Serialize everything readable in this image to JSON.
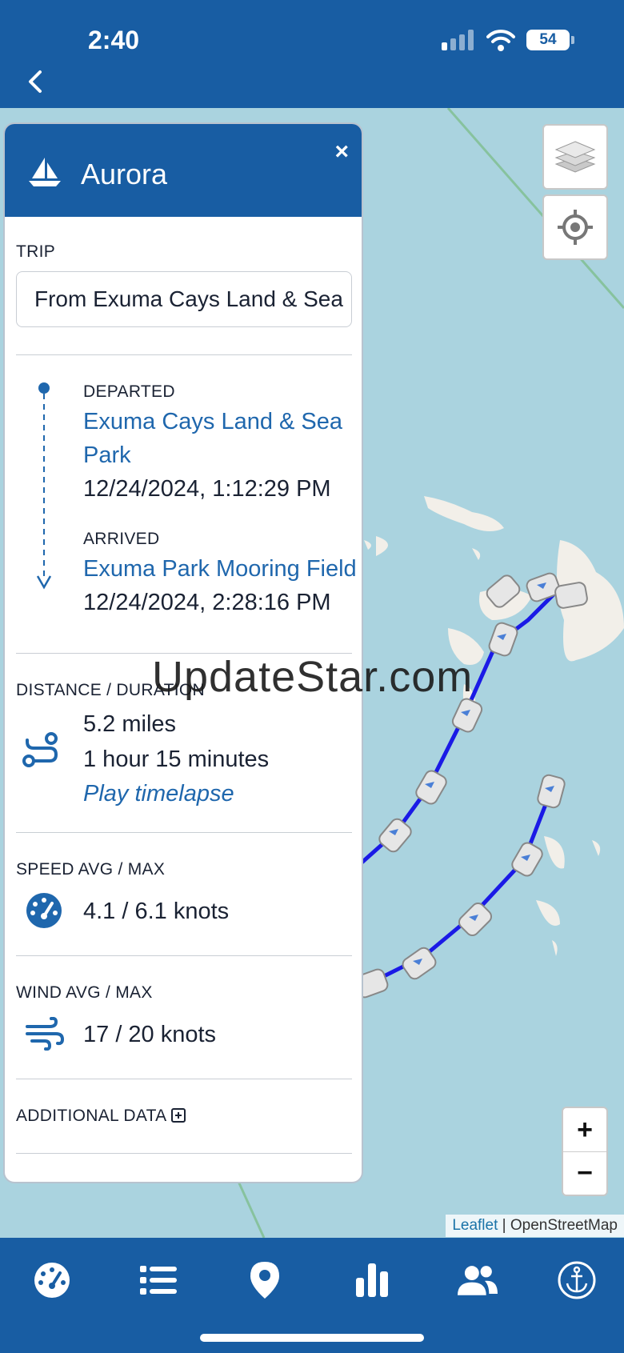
{
  "status_bar": {
    "time": "2:40",
    "battery": "54"
  },
  "panel": {
    "title": "Aurora",
    "close_label": "×",
    "trip_label": "TRIP",
    "trip_value": "From Exuma Cays Land & Sea Park",
    "departed_label": "DEPARTED",
    "departed_place": "Exuma Cays Land & Sea Park",
    "departed_time": "12/24/2024, 1:12:29 PM",
    "arrived_label": "ARRIVED",
    "arrived_place": "Exuma Park Mooring Field",
    "arrived_time": "12/24/2024, 2:28:16 PM",
    "distance_label": "DISTANCE / DURATION",
    "distance_value": "5.2 miles",
    "duration_value": "1 hour 15 minutes",
    "timelapse_label": "Play timelapse",
    "speed_label": "SPEED AVG / MAX",
    "speed_value": "4.1 / 6.1 knots",
    "wind_label": "WIND AVG / MAX",
    "wind_value": "17 / 20 knots",
    "additional_label": "ADDITIONAL DATA"
  },
  "map": {
    "zoom_in": "+",
    "zoom_out": "−",
    "attribution_leaflet": "Leaflet",
    "attribution_sep": " | ",
    "attribution_osm": "OpenStreetMap"
  },
  "watermark": "UpdateStar.com",
  "colors": {
    "brand_blue": "#185da3",
    "link_blue": "#1f67ad",
    "track_blue": "#1a1ae6",
    "water": "#aad3df"
  },
  "nav_icons": [
    "dashboard-icon",
    "list-icon",
    "map-pin-icon",
    "bar-chart-icon",
    "people-icon",
    "anchor-icon"
  ]
}
